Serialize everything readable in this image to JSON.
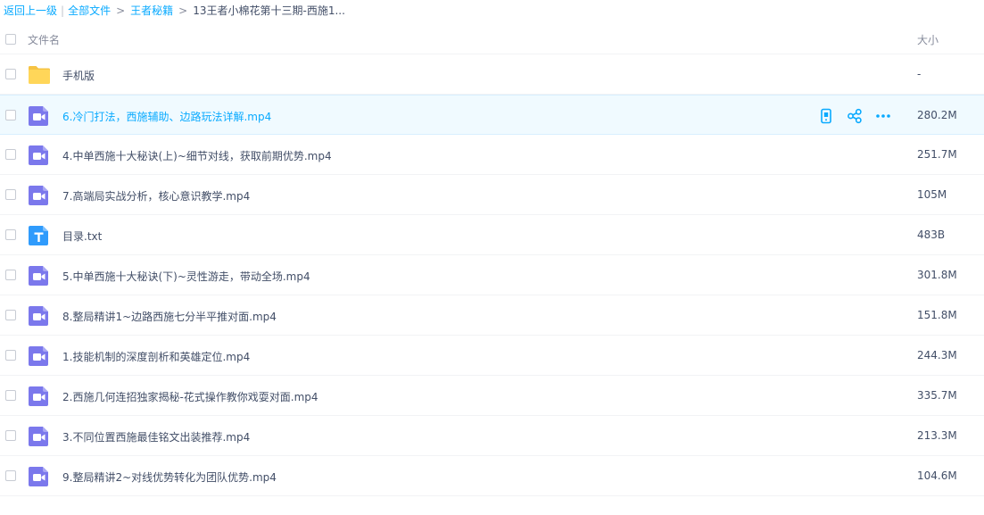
{
  "breadcrumb": {
    "back": "返回上一级",
    "sep": "|",
    "all_files": "全部文件",
    "gt1": ">",
    "folder": "王者秘籍",
    "gt2": ">",
    "current": "13王者小棉花第十三期-西施1..."
  },
  "header": {
    "name_label": "文件名",
    "size_label": "大小"
  },
  "files": [
    {
      "name": "手机版",
      "size": "-",
      "type": "folder-icon"
    },
    {
      "name": "6.冷门打法，西施辅助、边路玩法详解.mp4",
      "size": "280.2M",
      "type": "video-icon"
    },
    {
      "name": "4.中单西施十大秘诀(上)~细节对线，获取前期优势.mp4",
      "size": "251.7M",
      "type": "video-icon"
    },
    {
      "name": "7.高端局实战分析，核心意识教学.mp4",
      "size": "105M",
      "type": "video-icon"
    },
    {
      "name": "目录.txt",
      "size": "483B",
      "type": "text-file-icon"
    },
    {
      "name": "5.中单西施十大秘诀(下)~灵性游走，带动全场.mp4",
      "size": "301.8M",
      "type": "video-icon"
    },
    {
      "name": "8.整局精讲1~边路西施七分半平推对面.mp4",
      "size": "151.8M",
      "type": "video-icon"
    },
    {
      "name": "1.技能机制的深度剖析和英雄定位.mp4",
      "size": "244.3M",
      "type": "video-icon"
    },
    {
      "name": "2.西施几何连招独家揭秘-花式操作教你戏耍对面.mp4",
      "size": "335.7M",
      "type": "video-icon"
    },
    {
      "name": "3.不同位置西施最佳铭文出装推荐.mp4",
      "size": "213.3M",
      "type": "video-icon"
    },
    {
      "name": "9.整局精讲2~对线优势转化为团队优势.mp4",
      "size": "104.6M",
      "type": "video-icon"
    }
  ],
  "hovered_row": 1,
  "row_actions": [
    "phone-icon",
    "share-icon",
    "more-icon"
  ],
  "colors": {
    "accent": "#09aaff",
    "folder": "#ffd659",
    "video": "#7b78ec",
    "text_file": "#2f9bfc",
    "hover_bg": "#f0faff"
  }
}
